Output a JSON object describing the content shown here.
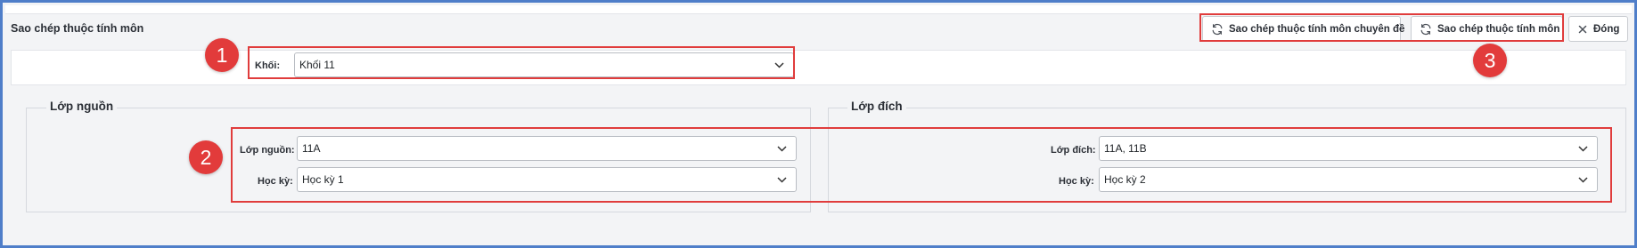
{
  "page": {
    "title": "Sao chép thuộc tính môn"
  },
  "toolbar": {
    "copy_special_label": "Sao chép thuộc tính môn chuyên đề",
    "copy_label": "Sao chép thuộc tính môn",
    "close_label": "Đóng"
  },
  "khoi": {
    "label": "Khối:",
    "value": "Khối 11"
  },
  "source": {
    "legend": "Lớp nguồn",
    "class_label": "Lớp nguồn:",
    "class_value": "11A",
    "term_label": "Học kỳ:",
    "term_value": "Học kỳ 1"
  },
  "target": {
    "legend": "Lớp đích",
    "class_label": "Lớp đích:",
    "class_value": "11A, 11B",
    "term_label": "Học kỳ:",
    "term_value": "Học kỳ 2"
  },
  "callouts": [
    "1",
    "2",
    "3"
  ],
  "colors": {
    "highlight": "#e03c3c",
    "badge": "#e23b3b",
    "frame": "#4f7ec9",
    "background": "#f3f4f6"
  },
  "icons": {
    "copy": "refresh-icon",
    "close": "close-icon",
    "dropdown": "chevron-down-icon"
  }
}
